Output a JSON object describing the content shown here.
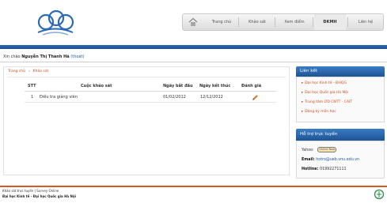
{
  "nav": {
    "items": [
      "Trang chủ",
      "Khảo sát",
      "Xem điểm",
      "ĐKMH",
      "Liên hệ"
    ],
    "active": "ĐKMH"
  },
  "user": {
    "greeting": "Xin chào",
    "name": "Nguyễn Thị Thanh Hà",
    "logout": "(thoát)"
  },
  "breadcrumb": {
    "home": "Trang chủ",
    "separator": "»",
    "current": "Khảo sát"
  },
  "table": {
    "headers": [
      "STT",
      "Cuộc khảo sát",
      "Ngày bắt đầu",
      "Ngày kết thúc",
      "Đánh giá"
    ],
    "rows": [
      {
        "stt": "1",
        "name": "Điều tra giảng viên",
        "start": "01/02/2012",
        "end": "12/12/2012"
      }
    ]
  },
  "sidebar": {
    "links_title": "Liên kết",
    "links": [
      "Đại học Kinh tế - ĐHQG",
      "Đại học Quốc gia Hà Nội",
      "Trung tâm ỨD CNTT - CAIT",
      "Đăng ký môn học"
    ],
    "support_title": "Hỗ trợ trực tuyến",
    "yahoo_label": "Yahoo:",
    "yahoo_button": "Online Now",
    "email_label": "Email:",
    "email": "hotro@ueb.vnu.edu.vn",
    "hotline_label": "Hotline:",
    "hotline": "01992271111"
  },
  "footer": {
    "line1": "Khảo sát trực tuyến | Survey Online",
    "line2": "Đại học Kinh tế - Đại học Quốc gia Hà Nội"
  },
  "colors": {
    "accent_blue": "#1f5a9e",
    "accent_orange": "#d14b1c"
  },
  "icons": [
    "logo-mark",
    "home-icon",
    "edit-pencil-icon",
    "university-logo"
  ]
}
